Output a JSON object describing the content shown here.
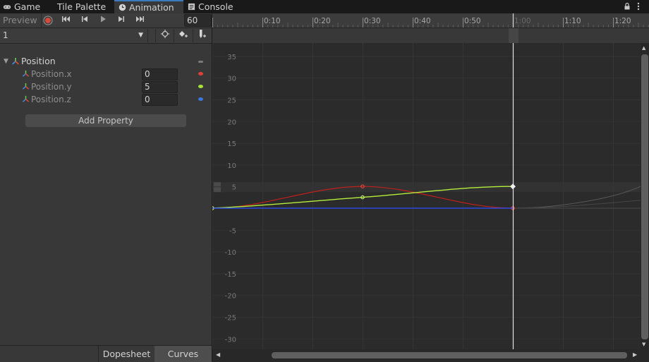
{
  "tabs": [
    {
      "label": "Game",
      "icon": "gamepad-icon"
    },
    {
      "label": "Tile Palette",
      "icon": ""
    },
    {
      "label": "Animation",
      "icon": "clock-icon",
      "active": true
    },
    {
      "label": "Console",
      "icon": "console-icon"
    }
  ],
  "toolbar": {
    "preview_label": "Preview",
    "sample_rate": "60",
    "clip_name": "1"
  },
  "properties": {
    "group_label": "Position",
    "items": [
      {
        "label": "Position.x",
        "value": "0",
        "color": "#e0403a"
      },
      {
        "label": "Position.y",
        "value": "5",
        "color": "#a6e23a"
      },
      {
        "label": "Position.z",
        "value": "0",
        "color": "#3a78e0"
      }
    ],
    "add_property_label": "Add Property"
  },
  "bottom_tabs": {
    "dopesheet": "Dopesheet",
    "curves": "Curves"
  },
  "timeline": {
    "ticks": [
      "0:10",
      "0:20",
      "0:30",
      "0:40",
      "0:50",
      "1:00",
      "1:10",
      "1:20"
    ]
  },
  "chart_data": {
    "type": "line",
    "x": [
      0,
      30,
      60
    ],
    "ylim": [
      -32,
      38
    ],
    "yticks": [
      35,
      30,
      25,
      20,
      15,
      10,
      5,
      0,
      -5,
      -10,
      -15,
      -20,
      -25,
      -30
    ],
    "ytick_labels": [
      "35",
      "30",
      "25",
      "20",
      "15",
      "10",
      "5",
      "",
      "-5",
      "-10",
      "-15",
      "-20",
      "-25",
      "-30"
    ],
    "series": [
      {
        "values": [
          0,
          5,
          0
        ],
        "color": "#c0201c"
      },
      {
        "values": [
          0,
          2.5,
          5
        ],
        "color": "#b4ee3c"
      },
      {
        "values": [
          0,
          0,
          0
        ],
        "color": "#2a4cff"
      }
    ]
  },
  "colors": {
    "record": "#d44a3a",
    "active_tab": "#3a79bb"
  }
}
